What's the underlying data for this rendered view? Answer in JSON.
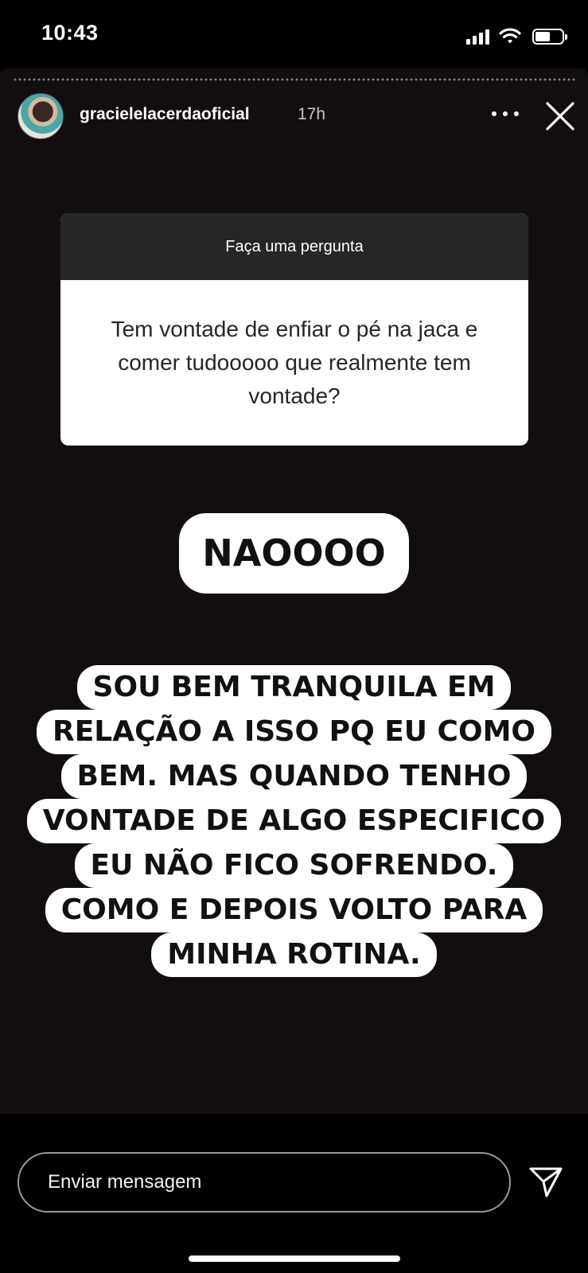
{
  "status_bar": {
    "time": "10:43"
  },
  "story": {
    "username": "gracielelacerdaoficial",
    "time_ago": "17h"
  },
  "question_sticker": {
    "header": "Faça uma pergunta",
    "question": "Tem vontade de enfiar o pé na jaca e comer tudooooo que realmente tem vontade?"
  },
  "answers": {
    "short": "NAOOOO",
    "long_lines": [
      "SOU BEM TRANQUILA EM",
      "RELAÇÃO A ISSO PQ EU COMO",
      "BEM. MAS QUANDO TENHO",
      "VONTADE DE ALGO ESPECIFICO",
      "EU NÃO FICO SOFRENDO.",
      "COMO E DEPOIS VOLTO PARA",
      "MINHA ROTINA."
    ]
  },
  "reply_bar": {
    "placeholder": "Enviar mensagem"
  },
  "icons": {
    "close": "close-icon",
    "more": "more-options-icon",
    "send": "send-icon",
    "wifi": "wifi-icon",
    "battery": "battery-icon",
    "signal": "cellular-signal-icon"
  }
}
